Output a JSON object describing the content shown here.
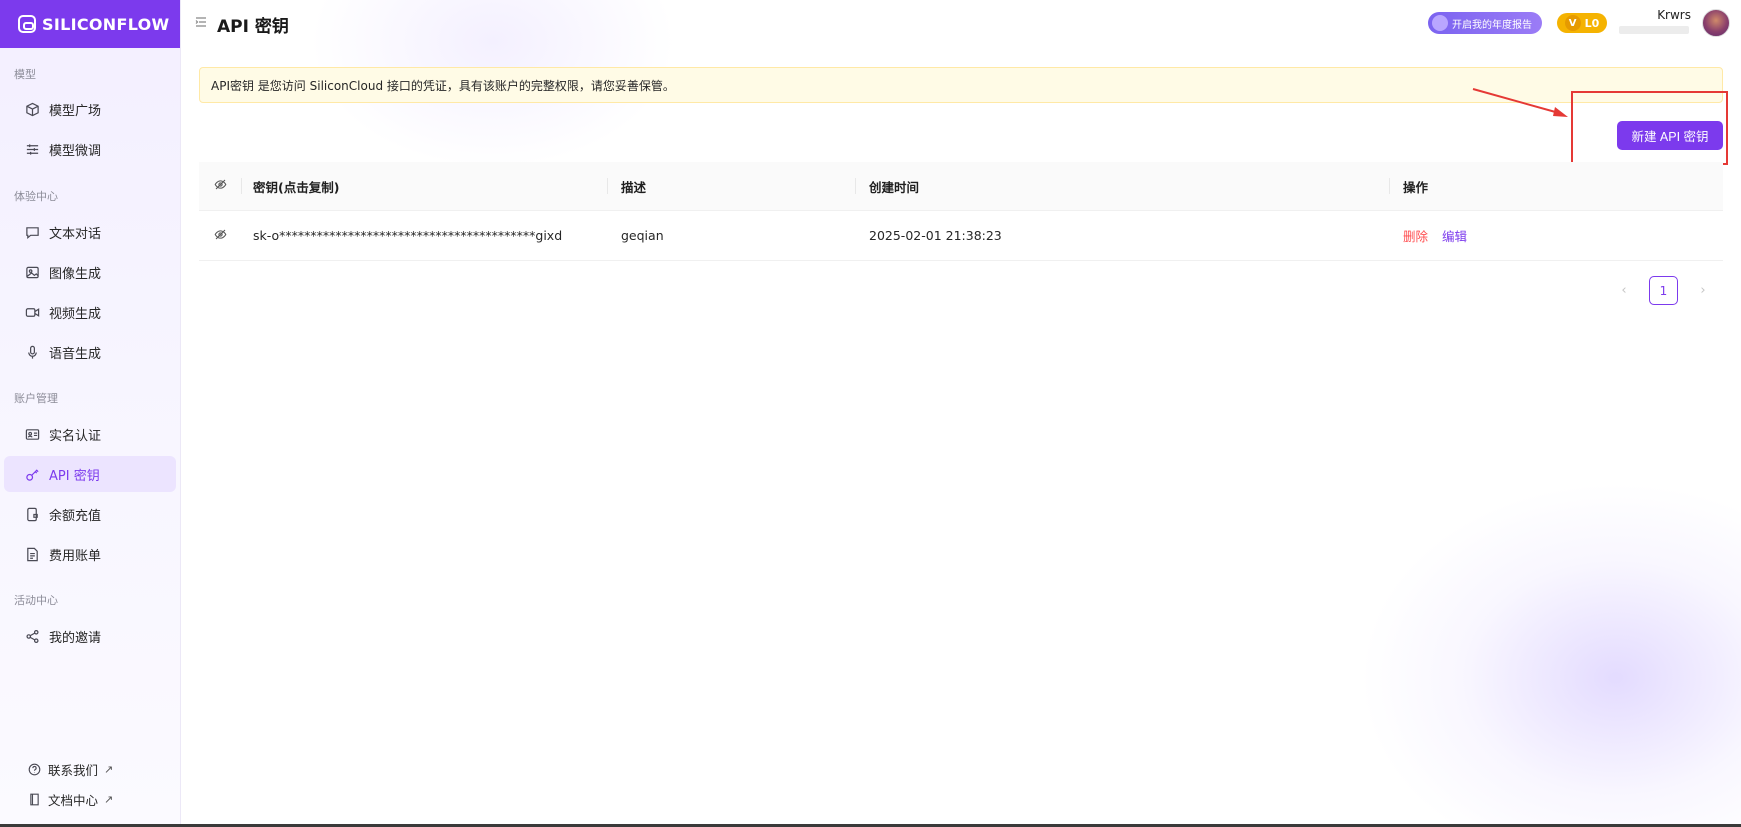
{
  "brand": {
    "name": "SILICONFLOW"
  },
  "sidebar": {
    "sections": [
      {
        "label": "模型"
      },
      {
        "label": "体验中心"
      },
      {
        "label": "账户管理"
      },
      {
        "label": "活动中心"
      }
    ],
    "items": [
      {
        "label": "模型广场",
        "icon": "cube-icon"
      },
      {
        "label": "模型微调",
        "icon": "sliders-icon"
      },
      {
        "label": "文本对话",
        "icon": "chat-icon"
      },
      {
        "label": "图像生成",
        "icon": "image-icon"
      },
      {
        "label": "视频生成",
        "icon": "video-icon"
      },
      {
        "label": "语音生成",
        "icon": "mic-icon"
      },
      {
        "label": "实名认证",
        "icon": "id-card-icon"
      },
      {
        "label": "API 密钥",
        "icon": "key-icon",
        "active": true
      },
      {
        "label": "余额充值",
        "icon": "wallet-icon"
      },
      {
        "label": "费用账单",
        "icon": "bill-icon"
      },
      {
        "label": "我的邀请",
        "icon": "share-icon"
      }
    ],
    "bottom_links": [
      {
        "label": "联系我们",
        "icon": "help-icon",
        "ext": "↗"
      },
      {
        "label": "文档中心",
        "icon": "book-icon",
        "ext": "↗"
      }
    ]
  },
  "header": {
    "title": "API 密钥",
    "report_label": "开启我的年度报告",
    "level": "L0",
    "level_mark": "V",
    "username": "Krwrs"
  },
  "notice": {
    "text": "API密钥 是您访问 SiliconCloud 接口的凭证，具有该账户的完整权限，请您妥善保管。"
  },
  "actions": {
    "new_key_label": "新建 API 密钥"
  },
  "table": {
    "columns": [
      "密钥(点击复制)",
      "描述",
      "创建时间",
      "操作"
    ],
    "rows": [
      {
        "key": "sk-o*****************************************gixd",
        "description": "geqian",
        "created": "2025-02-01 21:38:23",
        "delete_label": "删除",
        "edit_label": "编辑"
      }
    ]
  },
  "pagination": {
    "current": "1",
    "prev": "‹",
    "next": "›"
  },
  "colors": {
    "accent": "#7c3aed",
    "danger": "#ff4d4f",
    "notice_bg": "#fffbe6",
    "highlight": "#e53935"
  }
}
